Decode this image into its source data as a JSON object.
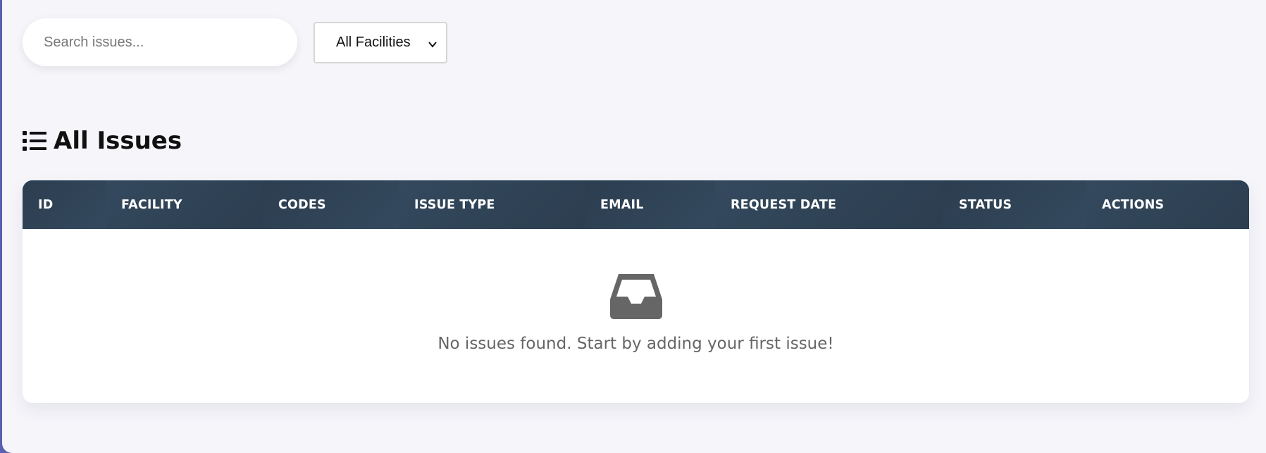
{
  "filters": {
    "search_placeholder": "Search issues...",
    "facility_select": {
      "selected": "All Facilities"
    }
  },
  "section": {
    "title": "All Issues",
    "icon": "list-icon"
  },
  "table": {
    "columns": [
      "ID",
      "FACILITY",
      "CODES",
      "ISSUE TYPE",
      "EMAIL",
      "REQUEST DATE",
      "STATUS",
      "ACTIONS"
    ],
    "rows": [],
    "empty_icon": "inbox-icon",
    "empty_message": "No issues found. Start by adding your first issue!"
  },
  "colors": {
    "background": "#f5f5fa",
    "accent_border": "#5a5fb0",
    "table_header": "#2f4357",
    "empty_text": "#666666",
    "icon_gray": "#666666"
  }
}
